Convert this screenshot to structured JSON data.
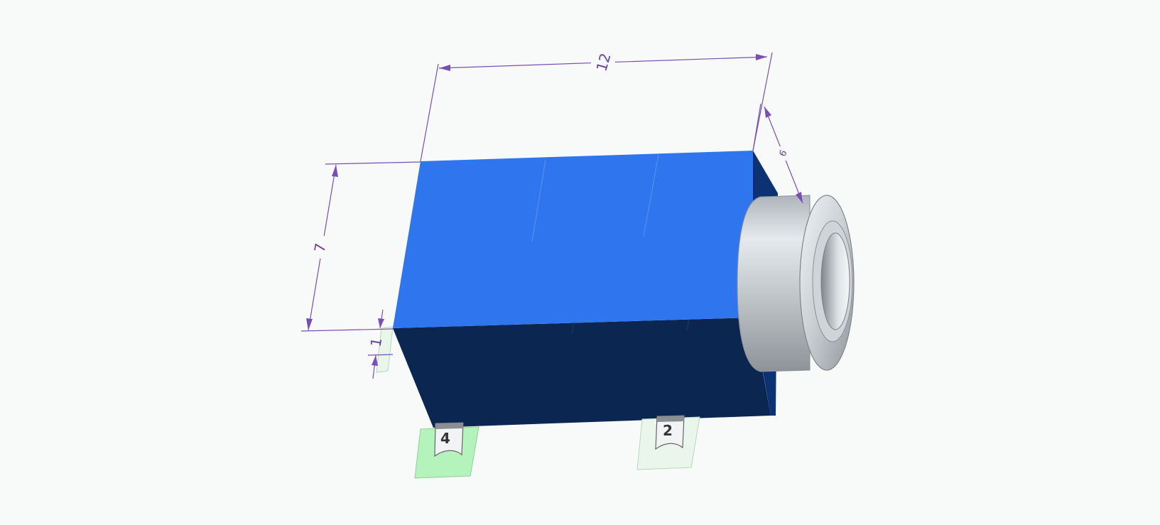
{
  "dimensions": {
    "length": "12",
    "height": "7",
    "depth": "6",
    "standoff": "1"
  },
  "pins": [
    {
      "label": "4"
    },
    {
      "label": "2"
    }
  ],
  "colors": {
    "background": "#f8f9f9",
    "body_top": "#2f76ee",
    "body_front": "#0b2651",
    "body_side": "#0d3273",
    "dimension": "#7a4fb5",
    "pad_selected": "#b5f3bd",
    "pad": "#eaf6ec",
    "bushing": "#c7ccd0"
  },
  "icons": [
    "audio-jack-3d-model",
    "dimension-arrow-icon",
    "solder-pad-icon"
  ]
}
